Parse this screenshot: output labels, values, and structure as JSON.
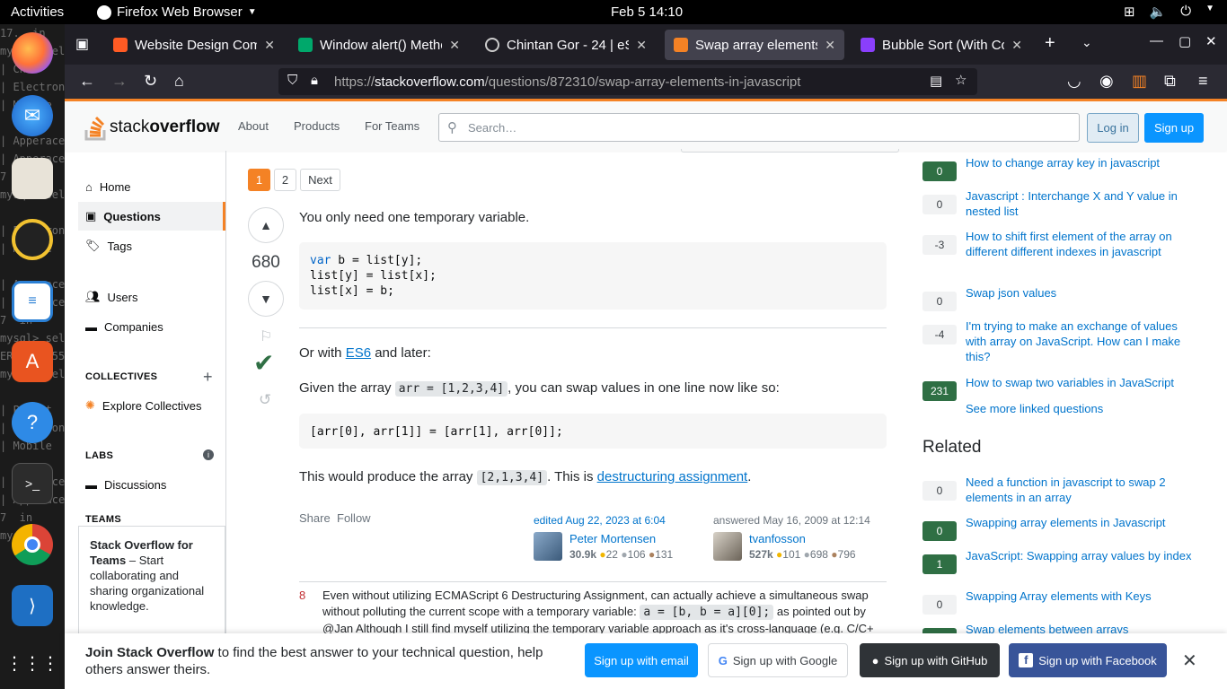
{
  "topbar": {
    "activities": "Activities",
    "app_name": "Firefox Web Browser",
    "clock": "Feb 5  14:10"
  },
  "dock": {
    "terminal_lines": [
      "17...in",
      "mysql> sel",
      "| Chi",
      "| Electron",
      "| Mobile",
      "",
      "| Apperace",
      "| Apperace",
      "7  in",
      "mysql> sel",
      "",
      "| Electron",
      "| Mobile",
      "",
      "| Apperace",
      "| Apperace",
      "7  in",
      "mysql> sel",
      "ERROR 1055",
      "mysql> sel",
      "",
      "| Parent",
      "| Electron",
      "| Mobile",
      "",
      "| Apperace",
      "| Apperace",
      "7  in",
      "mysql>"
    ]
  },
  "browser": {
    "tabs": [
      {
        "title": "Website Design Comp",
        "color": "#ff5b24"
      },
      {
        "title": "Window alert() Metho",
        "color": "#00a86b"
      },
      {
        "title": "Chintan Gor - 24 | eSpa",
        "color": "#cccccc"
      },
      {
        "title": "Swap array elements i",
        "color": "#f48225"
      },
      {
        "title": "Bubble Sort (With Cod",
        "color": "#8a3ffc"
      }
    ],
    "url_prefix": "https://",
    "url_host": "stackoverflow.com",
    "url_path": "/questions/872310/swap-array-elements-in-javascript"
  },
  "so_header": {
    "logo_light": "stack",
    "logo_bold": "overflow",
    "about": "About",
    "products": "Products",
    "for_teams": "For Teams",
    "search_placeholder": "Search…",
    "login": "Log in",
    "signup": "Sign up"
  },
  "leftnav": {
    "home": "Home",
    "questions": "Questions",
    "tags": "Tags",
    "users": "Users",
    "companies": "Companies",
    "collectives": "COLLECTIVES",
    "explore_collectives": "Explore Collectives",
    "labs": "LABS",
    "discussions": "Discussions",
    "teams": "TEAMS",
    "teams_title": "Stack Overflow for Teams",
    "teams_desc": " – Start collaborating and sharing organizational knowledge."
  },
  "pager": {
    "p1": "1",
    "p2": "2",
    "next": "Next"
  },
  "answer": {
    "score": "680",
    "line1": "You only need one temporary variable.",
    "code1": "var b = list[y];\nlist[y] = list[x];\nlist[x] = b;",
    "code1_kw": "var",
    "or_with": "Or with ",
    "es6": "ES6",
    "and_later": " and later:",
    "given": "Given the array ",
    "given_code": "arr = [1,2,3,4]",
    "given_rest": ", you can swap values in one line now like so:",
    "code2": "[arr[0], arr[1]] = [arr[1], arr[0]];",
    "produce": "This would produce the array ",
    "produce_code": "[2,1,3,4]",
    "produce_mid": ". This is ",
    "destructuring": "destructuring assignment",
    "produce_end": ".",
    "share": "Share",
    "follow": "Follow",
    "edited": "edited Aug 22, 2023 at 6:04",
    "editor": {
      "name": "Peter Mortensen",
      "rep": "30.9k",
      "gold": "22",
      "silver": "106",
      "bronze": "131"
    },
    "answered": "answered May 16, 2009 at 12:14",
    "author": {
      "name": "tvanfosson",
      "rep": "527k",
      "gold": "101",
      "silver": "698",
      "bronze": "796"
    }
  },
  "comment": {
    "score": "8",
    "text1": "Even without utilizing ECMAScript 6 Destructuring Assignment, can actually achieve a simultaneous swap",
    "text2a": "without polluting the current scope with a temporary variable: ",
    "text2code": "a = [b, b = a][0];",
    "text2b": " as pointed out by",
    "text3": "@Jan Although I still find myself utilizing the temporary variable approach as it's cross-language (e.g. C/C+"
  },
  "linked": [
    {
      "score": "0",
      "title": "How to change array key in javascript",
      "accepted": true
    },
    {
      "score": "0",
      "title": "Javascript : Interchange X and Y value in nested list",
      "accepted": false
    },
    {
      "score": "-3",
      "title": "How to shift first element of the array on different different indexes in javascript",
      "accepted": false
    },
    {
      "score": "0",
      "title": "Swap json values",
      "accepted": false
    },
    {
      "score": "-4",
      "title": "I'm trying to make an exchange of values with array on JavaScript. How can I make this?",
      "accepted": false
    },
    {
      "score": "231",
      "title": "How to swap two variables in JavaScript",
      "accepted": true
    }
  ],
  "see_more": "See more linked questions",
  "related_title": "Related",
  "related": [
    {
      "score": "0",
      "title": "Need a function in javascript to swap 2 elements in an array",
      "accepted": false
    },
    {
      "score": "0",
      "title": "Swapping array elements in Javascript",
      "accepted": true
    },
    {
      "score": "1",
      "title": "JavaScript: Swapping array values by index",
      "accepted": true
    },
    {
      "score": "0",
      "title": "Swapping Array elements with Keys",
      "accepted": false
    },
    {
      "score": "3",
      "title": "Swap elements between arrays",
      "accepted": true
    }
  ],
  "banner": {
    "bold": "Join Stack Overflow",
    "rest": " to find the best answer to your technical question, help others answer theirs.",
    "email": "Sign up with email",
    "google": "Sign up with Google",
    "github": "Sign up with GitHub",
    "facebook": "Sign up with Facebook"
  }
}
